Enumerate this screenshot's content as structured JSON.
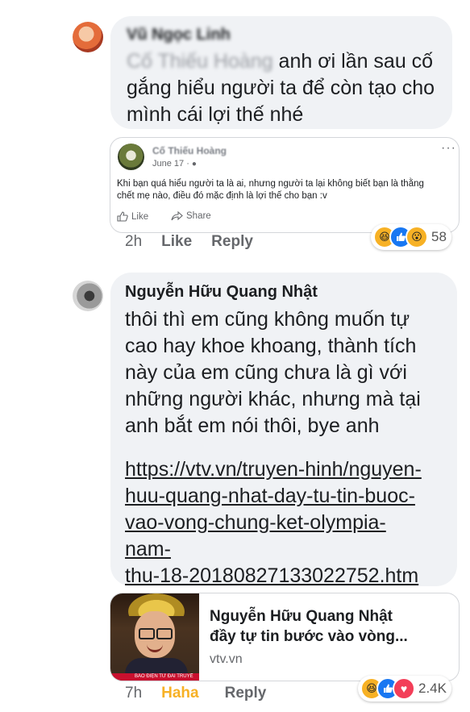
{
  "comment1": {
    "author_blurred": "Vũ Ngọc Linh",
    "text_blurred_prefix": "Cố Thiếu Hoàng",
    "text_line1": " anh ơi lần sau cố",
    "text_line2": "gắng hiểu người ta để còn tạo cho",
    "text_line3": "mình cái lợi thế nhé",
    "shared_post": {
      "author": "Cố Thiếu Hoàng",
      "date": "June 17 · ",
      "text_line1": "Khi bạn quá hiểu người ta là ai, nhưng người ta lại không biết bạn là thằng",
      "text_line2": "chết mẹ nào, điều đó mặc định là lợi thế cho bạn :v",
      "like_label": "Like",
      "share_label": "Share",
      "more_icon": "more-horizontal-icon"
    },
    "time": "2h",
    "like_label": "Like",
    "reply_label": "Reply",
    "reaction_count": "58",
    "reactions": [
      "haha",
      "like",
      "wow"
    ]
  },
  "comment2": {
    "author": "Nguyễn Hữu Quang Nhật",
    "text_lines": [
      "thôi thì em cũng không muốn tự",
      "cao hay khoe khoang, thành tích",
      "này của em cũng chưa là gì với",
      "những người khác, nhưng mà tại",
      "anh bắt em nói thôi, bye anh"
    ],
    "link_lines": [
      "https://vtv.vn/truyen-hinh/nguyen-",
      "huu-quang-nhat-day-tu-tin-buoc-",
      "vao-vong-chung-ket-olympia-",
      "nam-",
      "thu-18-20180827133022752.htm"
    ],
    "preview": {
      "title_line1": "Nguyễn Hữu Quang Nhật",
      "title_line2": "đầy tự tin bước vào vòng...",
      "domain": "vtv.vn",
      "thumb_caption": "BÁO ĐIỆN TỬ ĐÀI TRUYỀ"
    },
    "time": "7h",
    "haha_label": "Haha",
    "reply_label": "Reply",
    "reaction_count": "2.4K",
    "reactions": [
      "haha",
      "like",
      "love"
    ]
  },
  "colors": {
    "bubble": "#f0f2f5",
    "haha_active": "#f7b125",
    "like_blue": "#1877f2",
    "love_red": "#f33e58"
  }
}
